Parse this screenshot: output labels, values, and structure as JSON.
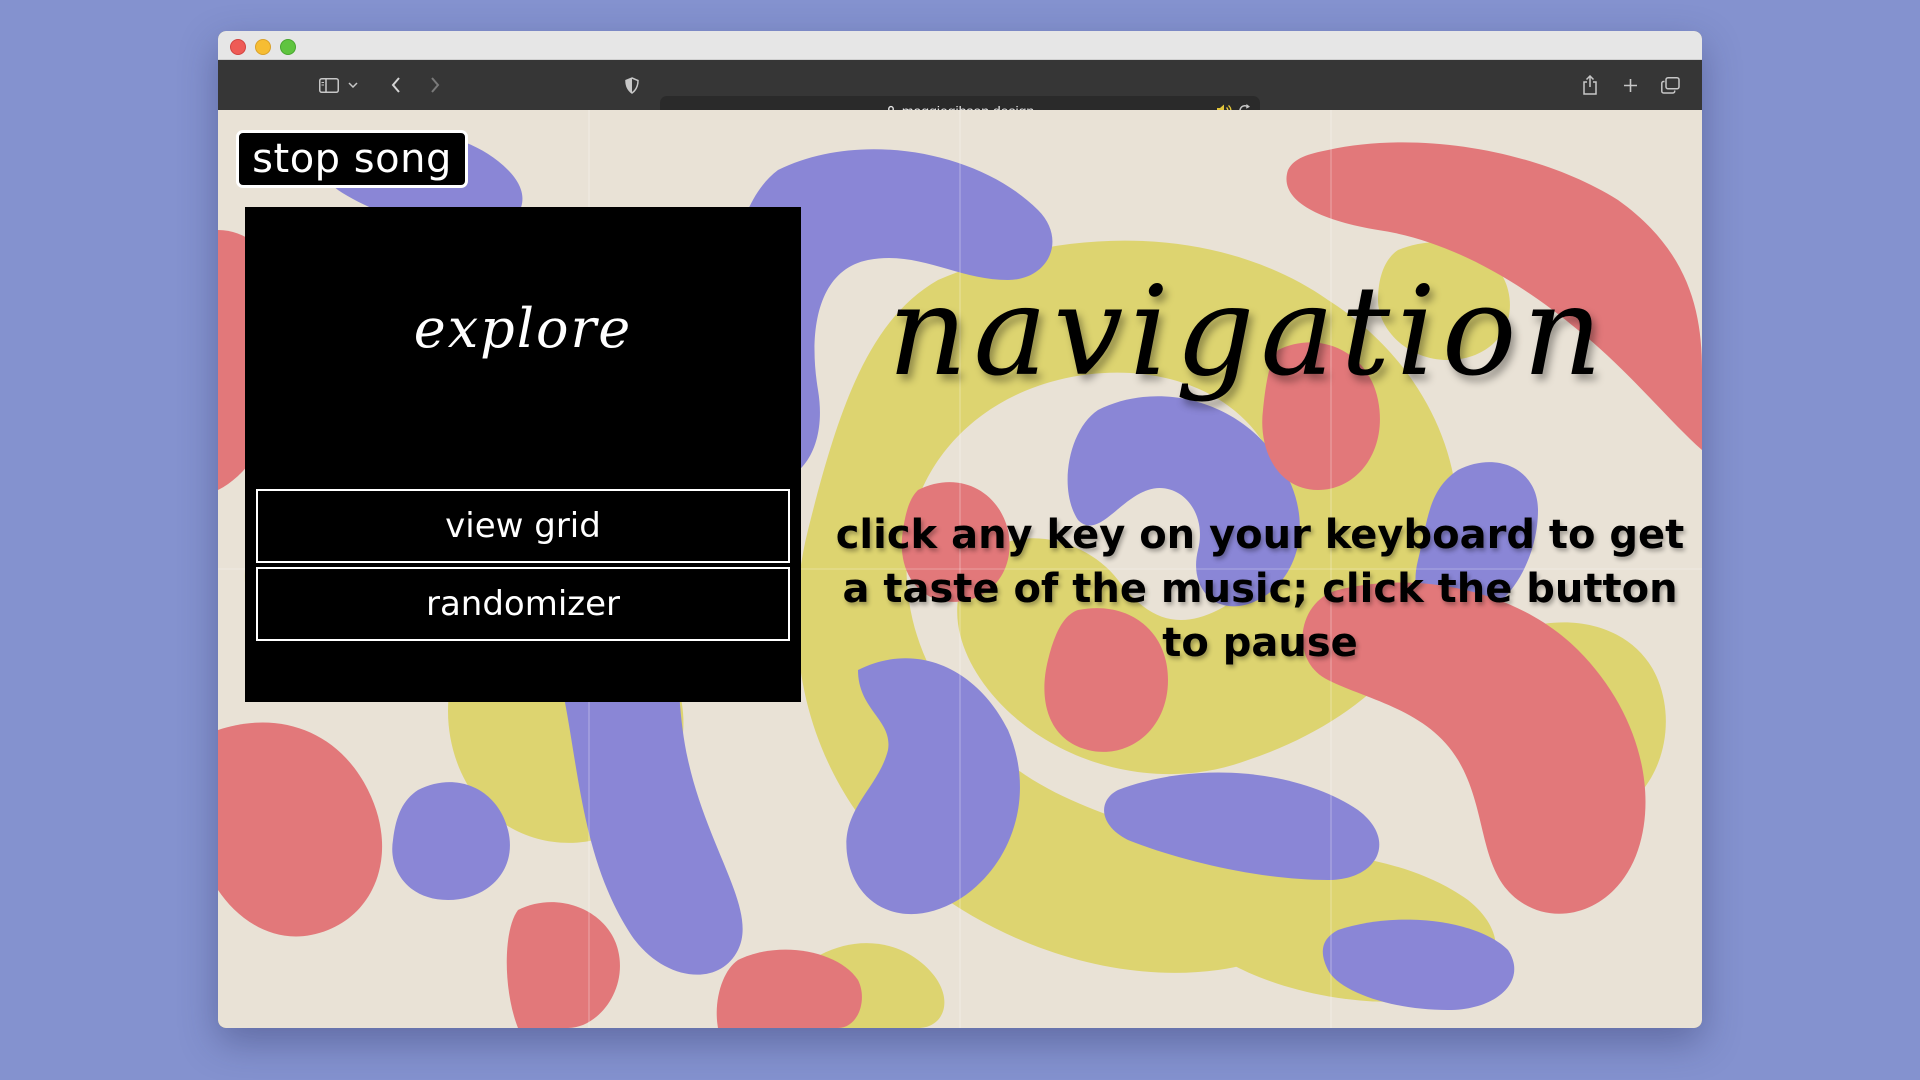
{
  "browser": {
    "url": "maggiegibson.design",
    "traffic_lights": {
      "close": "#ee5b56",
      "minimize": "#f6bd33",
      "zoom": "#5fc43f"
    },
    "toolbar_icons": [
      "sidebar-icon",
      "chevron-down-icon",
      "back-icon",
      "forward-icon",
      "shield-icon",
      "lock-icon",
      "speaker-icon",
      "reload-icon",
      "share-icon",
      "new-tab-icon",
      "tabs-overview-icon"
    ]
  },
  "page": {
    "stop_button_label": "stop song",
    "panel": {
      "heading": "explore",
      "buttons": [
        "view grid",
        "randomizer"
      ]
    },
    "title": "navigation",
    "description": "click any key on your keyboard to get a taste of the music; click the button to pause"
  },
  "colors": {
    "backdrop": "#8492cf",
    "paper": "#e9e2d6",
    "blob_purple": "#8a86d6",
    "blob_red": "#e2787a",
    "blob_yellow": "#ddd470"
  }
}
